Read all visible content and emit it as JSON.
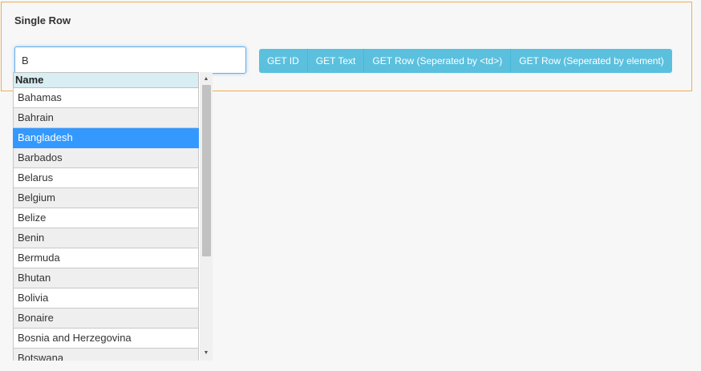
{
  "panel": {
    "title": "Single Row"
  },
  "search": {
    "value": "B"
  },
  "buttons": [
    {
      "label": "GET ID"
    },
    {
      "label": "GET Text"
    },
    {
      "label": "GET Row (Seperated by <td>)"
    },
    {
      "label": "GET Row (Seperated by element)"
    }
  ],
  "dropdown": {
    "header": "Name",
    "items": [
      {
        "label": "Bahamas"
      },
      {
        "label": "Bahrain"
      },
      {
        "label": "Bangladesh"
      },
      {
        "label": "Barbados"
      },
      {
        "label": "Belarus"
      },
      {
        "label": "Belgium"
      },
      {
        "label": "Belize"
      },
      {
        "label": "Benin"
      },
      {
        "label": "Bermuda"
      },
      {
        "label": "Bhutan"
      },
      {
        "label": "Bolivia"
      },
      {
        "label": "Bonaire"
      },
      {
        "label": "Bosnia and Herzegovina"
      },
      {
        "label": "Botswana"
      }
    ],
    "selected": "Bangladesh"
  },
  "colors": {
    "panel_border": "#f0ad4e",
    "button_bg": "#5bc0de",
    "selected_row": "#3399ff",
    "header_bg": "#d9eef3"
  }
}
